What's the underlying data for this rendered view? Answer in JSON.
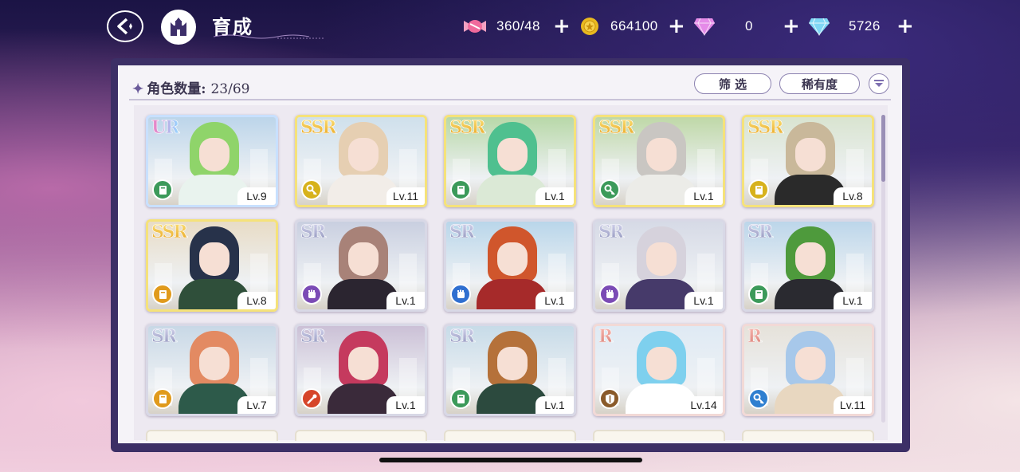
{
  "header": {
    "title": "育成",
    "resources": [
      {
        "id": "stamina",
        "icon": "candy-icon",
        "value": "360/48"
      },
      {
        "id": "gold",
        "icon": "gold-coin-icon",
        "value": "664100"
      },
      {
        "id": "pink-gem",
        "icon": "pink-diamond-icon",
        "value": "0"
      },
      {
        "id": "blue-gem",
        "icon": "blue-diamond-icon",
        "value": "5726"
      }
    ]
  },
  "panel": {
    "count_label": "角色数量:",
    "count_value": "23/69",
    "filter_label": "筛 选",
    "sort_label": "稀有度"
  },
  "characters": [
    {
      "rarity": "UR",
      "level": "Lv.9",
      "role": "book",
      "role_color": "#3c9a5a",
      "hair": "#8fd46a",
      "body": "#e9f3ee",
      "sky": "#bcd5ea"
    },
    {
      "rarity": "SSR",
      "level": "Lv.11",
      "role": "key",
      "role_color": "#d7b21c",
      "hair": "#e6cfb2",
      "body": "#f2ede8",
      "sky": "#cfe0ec"
    },
    {
      "rarity": "SSR",
      "level": "Lv.1",
      "role": "book",
      "role_color": "#3c9a5a",
      "hair": "#4fc08f",
      "body": "#dbe9d6",
      "sky": "#b8d8a8"
    },
    {
      "rarity": "SSR",
      "level": "Lv.1",
      "role": "key",
      "role_color": "#3c9a5a",
      "hair": "#c9c6c2",
      "body": "#ecece8",
      "sky": "#bfd8a7"
    },
    {
      "rarity": "SSR",
      "level": "Lv.8",
      "role": "book",
      "role_color": "#d7b21c",
      "hair": "#c9b89a",
      "body": "#2a2a2a",
      "sky": "#d9e4d0"
    },
    {
      "rarity": "SSR",
      "level": "Lv.8",
      "role": "book",
      "role_color": "#e09a1c",
      "hair": "#27324a",
      "body": "#2f4f3a",
      "sky": "#e8dcc6"
    },
    {
      "rarity": "SR",
      "level": "Lv.1",
      "role": "fist",
      "role_color": "#7b4bb5",
      "hair": "#a88278",
      "body": "#2b2530",
      "sky": "#c9cfe0"
    },
    {
      "rarity": "SR",
      "level": "Lv.1",
      "role": "fist",
      "role_color": "#2f6fd0",
      "hair": "#d0562c",
      "body": "#a62a2a",
      "sky": "#b9d6ea"
    },
    {
      "rarity": "SR",
      "level": "Lv.1",
      "role": "fist",
      "role_color": "#7b4bb5",
      "hair": "#d6d2dc",
      "body": "#463a6a",
      "sky": "#d6dae6"
    },
    {
      "rarity": "SR",
      "level": "Lv.1",
      "role": "book",
      "role_color": "#3c9a5a",
      "hair": "#4e9a3c",
      "body": "#2a2a30",
      "sky": "#bcd6ea"
    },
    {
      "rarity": "SR",
      "level": "Lv.7",
      "role": "book",
      "role_color": "#e09a1c",
      "hair": "#e38a62",
      "body": "#2d5a4a",
      "sky": "#c8d8e6"
    },
    {
      "rarity": "SR",
      "level": "Lv.1",
      "role": "wand",
      "role_color": "#d6452a",
      "hair": "#c53a5e",
      "body": "#3a2a3a",
      "sky": "#cbc0d6"
    },
    {
      "rarity": "SR",
      "level": "Lv.1",
      "role": "book",
      "role_color": "#3c9a5a",
      "hair": "#b5713a",
      "body": "#2c4a3e",
      "sky": "#c7dbe8"
    },
    {
      "rarity": "R",
      "level": "Lv.14",
      "role": "shield",
      "role_color": "#8a5a2a",
      "hair": "#7ed0ee",
      "body": "#ffffff",
      "sky": "#dfeaf4"
    },
    {
      "rarity": "R",
      "level": "Lv.11",
      "role": "key",
      "role_color": "#2f7fd0",
      "hair": "#a7c8ea",
      "body": "#e8d7c0",
      "sky": "#e6e2da"
    }
  ]
}
